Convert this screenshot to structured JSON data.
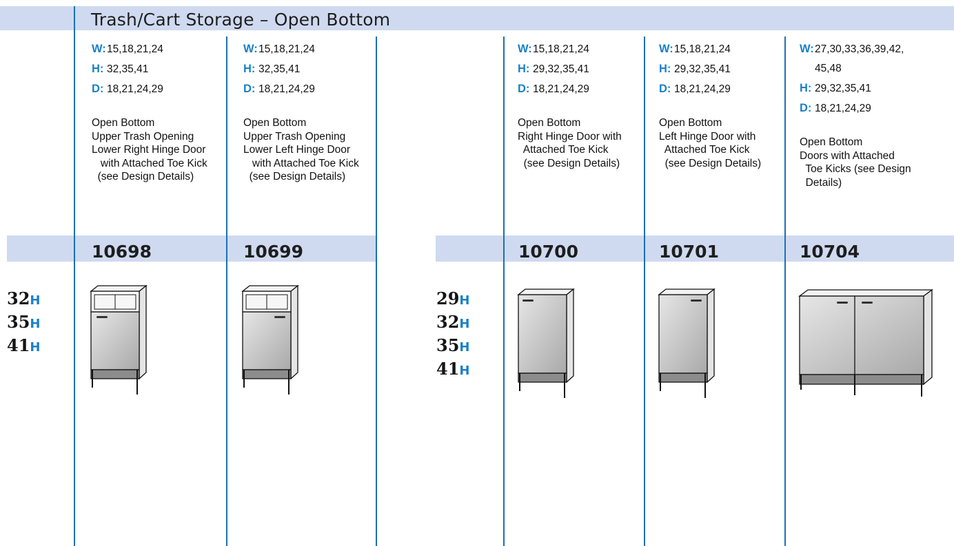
{
  "section_title": "Trash/Cart Storage – Open Bottom",
  "heights_left": [
    {
      "n": "32",
      "u": "H"
    },
    {
      "n": "35",
      "u": "H"
    },
    {
      "n": "41",
      "u": "H"
    }
  ],
  "heights_right": [
    {
      "n": "29",
      "u": "H"
    },
    {
      "n": "32",
      "u": "H"
    },
    {
      "n": "35",
      "u": "H"
    },
    {
      "n": "41",
      "u": "H"
    }
  ],
  "items": [
    {
      "code": "10698",
      "w_label": "W:",
      "w": "15,18,21,24",
      "h_label": "H:",
      "h": "32,35,41",
      "d_label": "D:",
      "d": "18,21,24,29",
      "desc": "Open Bottom\nUpper Trash Opening\nLower Right Hinge Door\n   with Attached Toe Kick\n  (see Design Details)"
    },
    {
      "code": "10699",
      "w_label": "W:",
      "w": "15,18,21,24",
      "h_label": "H:",
      "h": "32,35,41",
      "d_label": "D:",
      "d": "18,21,24,29",
      "desc": "Open Bottom\nUpper Trash Opening\nLower Left Hinge Door\n   with Attached Toe Kick\n  (see Design Details)"
    },
    {
      "code": "10700",
      "w_label": "W:",
      "w": "15,18,21,24",
      "h_label": "H:",
      "h": "29,32,35,41",
      "d_label": "D:",
      "d": "18,21,24,29",
      "desc": "Open Bottom\nRight Hinge Door with\n  Attached Toe Kick\n  (see Design Details)"
    },
    {
      "code": "10701",
      "w_label": "W:",
      "w": "15,18,21,24",
      "h_label": "H:",
      "h": "29,32,35,41",
      "d_label": "D:",
      "d": "18,21,24,29",
      "desc": "Open Bottom\nLeft Hinge Door with\n  Attached Toe Kick\n  (see Design Details)"
    },
    {
      "code": "10704",
      "w_label": "W:",
      "w1": "27,30,33,36,39,42,",
      "w2": "45,48",
      "h_label": "H:",
      "h": "29,32,35,41",
      "d_label": "D:",
      "d": "18,21,24,29",
      "desc": "Open Bottom\nDoors with Attached\n  Toe Kicks (see Design\n  Details)"
    }
  ],
  "colors": {
    "band": "#cfdaf0",
    "rule": "#1a6fb6",
    "accent": "#1a80c8"
  }
}
